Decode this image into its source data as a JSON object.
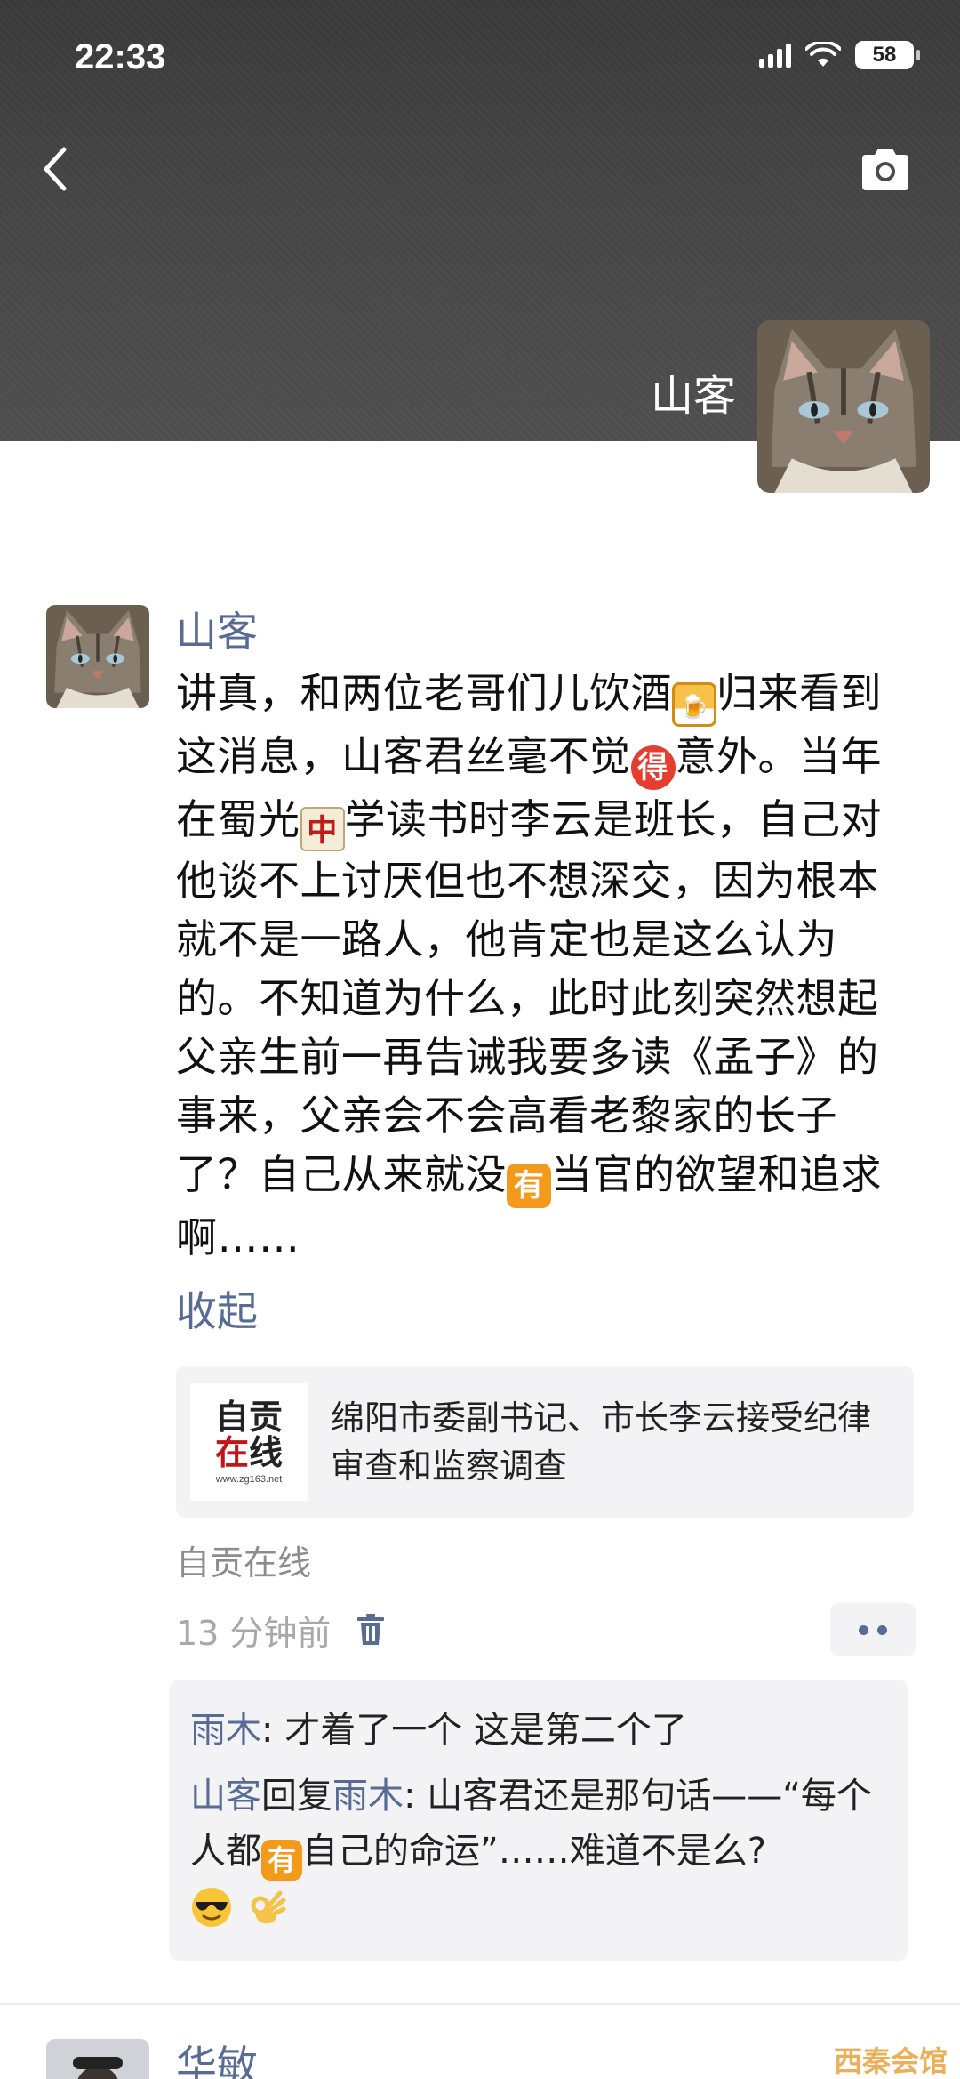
{
  "status_bar": {
    "time": "22:33",
    "battery": "58"
  },
  "header": {
    "profile_name": "山客"
  },
  "post": {
    "author": "山客",
    "text_segments": [
      "讲真，和两位老哥们儿饮酒",
      "归来看到这消息，山客君丝毫不觉",
      "意外。当年在蜀光",
      "学读书时李云是班长，自己对他谈不上讨厌但也不想深交，因为根本就不是一路人，他肯定也是这么认为的。不知道为什么，此时此刻突然想起父亲生前一再告诫我要多读《孟子》的事来，父亲会不会高看老黎家的长子了？自己从来就没",
      "当官的欲望和追求啊……"
    ],
    "emojis": {
      "beer": "🍺",
      "de": "得",
      "zhong": "中",
      "you": "有"
    },
    "collapse_label": "收起",
    "link": {
      "thumb_logo_top": "自贡",
      "thumb_logo_red": "在",
      "thumb_logo_rest": "线",
      "thumb_url": "www.zg163.net",
      "title": "绵阳市委副书记、市长李云接受纪律审查和监察调查"
    },
    "source": "自贡在线",
    "time": "13 分钟前"
  },
  "comments": [
    {
      "name": "雨木",
      "text": ": 才着了一个 这是第二个了"
    },
    {
      "name": "山客",
      "reply_word": "回复",
      "reply_to": "雨木",
      "text_before": ": 山客君还是那句话——“每个人都",
      "emoji": "有",
      "text_after": "自己的命运”……难道不是么?"
    }
  ],
  "next_post": {
    "author": "华敏"
  },
  "watermark": "西秦会馆"
}
